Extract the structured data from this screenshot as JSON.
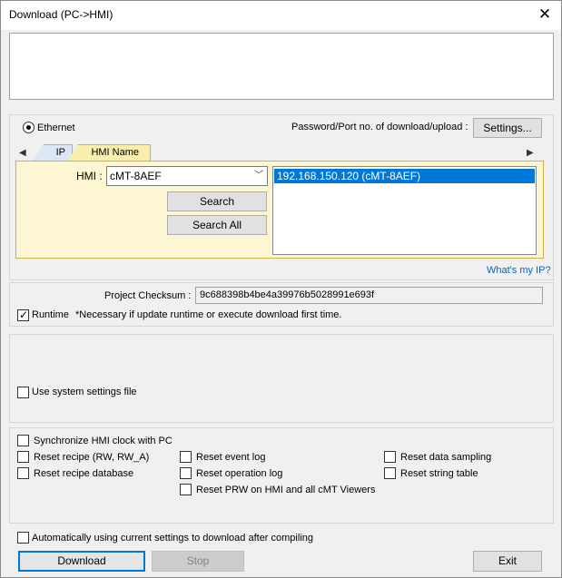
{
  "window": {
    "title": "Download (PC->HMI)",
    "close_glyph": "✕"
  },
  "connection": {
    "ethernet_label": "Ethernet",
    "password_label": "Password/Port no. of download/upload :",
    "settings_button": "Settings..."
  },
  "tabs": {
    "items": [
      {
        "label": "IP"
      },
      {
        "label": "HMI Name"
      }
    ],
    "active": "HMI Name"
  },
  "hmi": {
    "label": "HMI :",
    "selected_value": "cMT-8AEF",
    "search_button": "Search",
    "search_all_button": "Search All",
    "list_items": [
      "192.168.150.120 (cMT-8AEF)"
    ],
    "whats_my_ip_link": "What's my IP?"
  },
  "project": {
    "checksum_label": "Project Checksum :",
    "checksum_value": "9c688398b4be4a39976b5028991e693f",
    "runtime_label": "Runtime",
    "runtime_checked": true,
    "runtime_note": "*Necessary if update runtime or execute download first time."
  },
  "system": {
    "use_system_settings_label": "Use system settings file"
  },
  "options": {
    "sync_clock": "Synchronize HMI clock with PC",
    "reset_recipe": "Reset recipe (RW, RW_A)",
    "reset_recipe_database": "Reset recipe database",
    "reset_event_log": "Reset event log",
    "reset_operation_log": "Reset operation log",
    "reset_prw": "Reset PRW on HMI and all cMT Viewers",
    "reset_data_sampling": "Reset data sampling",
    "reset_string_table": "Reset string table"
  },
  "footer": {
    "auto_download_label": "Automatically using current settings to download after compiling",
    "download_button": "Download",
    "stop_button": "Stop",
    "exit_button": "Exit"
  },
  "icons": {
    "close": "close-icon",
    "tab_left": "chevron-left-icon",
    "tab_right": "chevron-right-icon",
    "combo": "chevron-down-icon",
    "check": "checkmark-icon"
  },
  "colors": {
    "accent": "#0078d7",
    "tab_active": "#f9eeab",
    "panel": "#fcf6d2",
    "link": "#0066cc"
  }
}
